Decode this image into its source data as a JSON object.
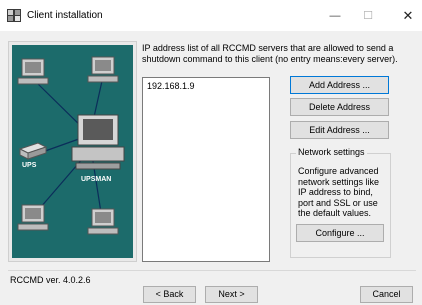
{
  "window": {
    "title": "Client installation",
    "icon": "installer-icon",
    "minimize_glyph": "—",
    "maximize_glyph": "☐",
    "close_glyph": "✕"
  },
  "graphic": {
    "ups_label": "UPS",
    "upsman_label": "UPSMAN",
    "background_color": "#1c6b6b"
  },
  "main": {
    "description": "IP address list of all RCCMD servers that are allowed to send a shutdown command to this client (no entry means:every server).",
    "ip_list": [
      "192.168.1.9"
    ],
    "add_label": "Add Address ...",
    "delete_label": "Delete Address",
    "edit_label": "Edit Address ..."
  },
  "network_settings": {
    "title": "Network settings",
    "description": "Configure advanced network settings like IP address to bind, port and SSL or use the default values.",
    "configure_label": "Configure ..."
  },
  "footer": {
    "version": "RCCMD ver. 4.0.2.6",
    "back_label": "< Back",
    "next_label": "Next >",
    "cancel_label": "Cancel"
  }
}
